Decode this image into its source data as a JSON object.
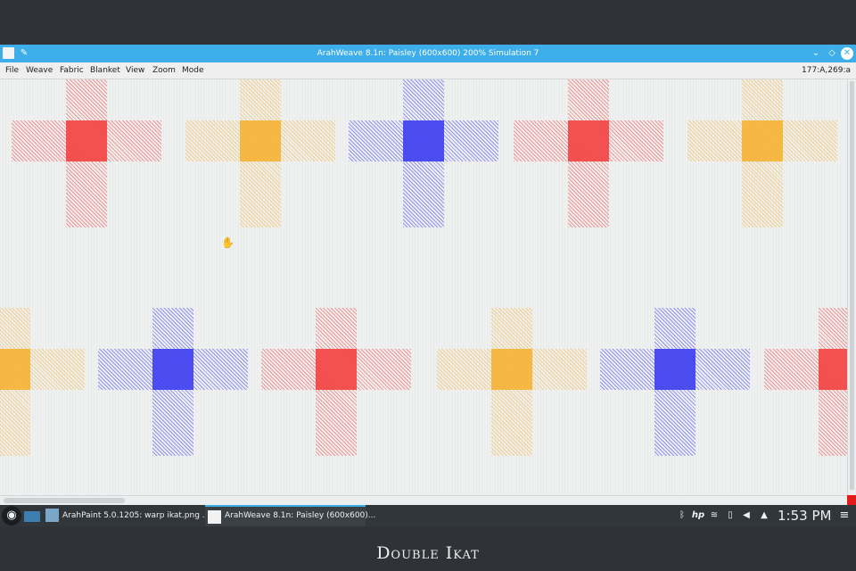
{
  "window": {
    "title": "ArahWeave 8.1n: Paisley (600x600) 200% Simulation 7",
    "pin_icon": "pin-icon",
    "controls": [
      "chevron-down-icon",
      "diamond-icon",
      "close-icon"
    ]
  },
  "menu": {
    "items": [
      "File",
      "Weave",
      "Fabric",
      "Blanket",
      "View",
      "Zoom",
      "Mode"
    ],
    "coords": "177:A,269:a"
  },
  "fabric": {
    "colors": {
      "red": "#f24a4a",
      "orange": "#f6b43c",
      "blue": "#4646f0"
    },
    "rows": [
      [
        "red",
        "orange",
        "blue",
        "red",
        "orange"
      ],
      [
        "orange",
        "blue",
        "red",
        "orange",
        "blue",
        "red"
      ]
    ]
  },
  "taskbar": {
    "tasks": [
      {
        "label": "ArahPaint 5.0.1205: warp ikat.png ..."
      },
      {
        "label": "ArahWeave 8.1n: Paisley (600x600)..."
      }
    ],
    "tray_icons": [
      "bluetooth-icon",
      "hp-icon",
      "wifi-icon",
      "clipboard-icon",
      "volume-icon",
      "arrow-up-icon"
    ],
    "clock": "1:53 PM"
  },
  "caption": "Double Ikat"
}
